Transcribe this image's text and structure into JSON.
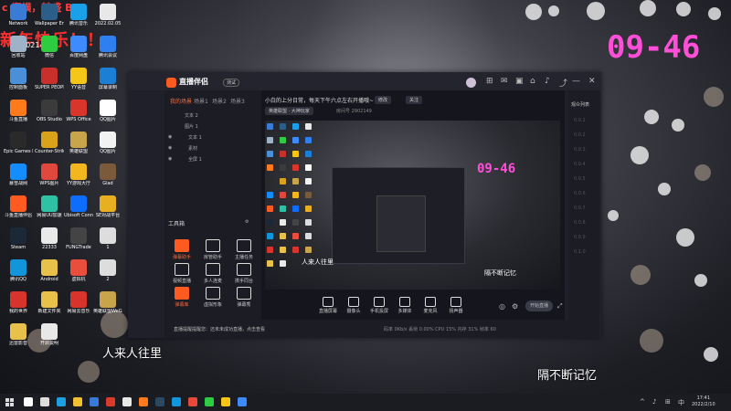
{
  "desktop": {
    "banner": "c 楔横，转盛 B",
    "new_year": "新年快乐！！",
    "count": "2902149",
    "clock": "09-46",
    "overlay_left": "人来人往里",
    "overlay_right": "隔不断记忆",
    "icons": [
      {
        "label": "Network",
        "color": "#3a7bd5"
      },
      {
        "label": "Wallpaper Engine",
        "color": "#2b5f8a"
      },
      {
        "label": "腾讯音乐",
        "color": "#1aa0e8"
      },
      {
        "label": "2022.02.05",
        "color": "#e8e8e8"
      },
      {
        "label": "回收站",
        "color": "#9fb3c8"
      },
      {
        "label": "微信",
        "color": "#2ecc40"
      },
      {
        "label": "百度网盘",
        "color": "#3d8bfd"
      },
      {
        "label": "腾讯会议",
        "color": "#2f7ff0"
      },
      {
        "label": "控制面板",
        "color": "#4a90d9"
      },
      {
        "label": "SUPER PEOPLE CBT",
        "color": "#c9302c"
      },
      {
        "label": "YY语音",
        "color": "#f5c518"
      },
      {
        "label": "屏幕录制",
        "color": "#1c7fd6"
      },
      {
        "label": "斗鱼直播",
        "color": "#ff7a1a"
      },
      {
        "label": "OBS Studio",
        "color": "#3b3b3b"
      },
      {
        "label": "WPS Office",
        "color": "#d9352b"
      },
      {
        "label": "QQ图片",
        "color": "#ffffff"
      },
      {
        "label": "Epic Games Launcher",
        "color": "#2a2a2a"
      },
      {
        "label": "Counter-Strike Global Off",
        "color": "#d9a21a"
      },
      {
        "label": "英雄联盟",
        "color": "#c8a44a"
      },
      {
        "label": "QQ图片",
        "color": "#f2f2f2"
      },
      {
        "label": "暴雪战网",
        "color": "#148eff"
      },
      {
        "label": "WPS图片",
        "color": "#e0483d"
      },
      {
        "label": "YY游戏大厅",
        "color": "#f3b61f"
      },
      {
        "label": "Glad",
        "color": "#7a5a3a"
      },
      {
        "label": "斗鱼直播伴侣",
        "color": "#ff5a1f"
      },
      {
        "label": "网易UU加速",
        "color": "#2fc1a3"
      },
      {
        "label": "Ubisoft Connect",
        "color": "#0d6efd"
      },
      {
        "label": "SE对战平台",
        "color": "#e8b020"
      },
      {
        "label": "Steam",
        "color": "#1b2838"
      },
      {
        "label": "22333",
        "color": "#e9e9e9"
      },
      {
        "label": "FUNGTrade",
        "color": "#444444"
      },
      {
        "label": "1",
        "color": "#dddddd"
      },
      {
        "label": "腾讯QQ",
        "color": "#1296db"
      },
      {
        "label": "Android",
        "color": "#e8c14a"
      },
      {
        "label": "虚拟机",
        "color": "#e94e3c"
      },
      {
        "label": "2",
        "color": "#dddddd"
      },
      {
        "label": "我的世界",
        "color": "#d9342b"
      },
      {
        "label": "新建文件夹",
        "color": "#e8c14a"
      },
      {
        "label": "网易云音乐",
        "color": "#d9342b"
      },
      {
        "label": "英雄联盟WeGame",
        "color": "#c9a44a"
      },
      {
        "label": "迅雷影音",
        "color": "#e8c14a"
      },
      {
        "label": "开启说明",
        "color": "#e8e8e8"
      }
    ]
  },
  "window": {
    "app_name": "直播伴侣",
    "version": "测试",
    "controls": {
      "minimize": "—",
      "maximize": "□",
      "close": "✕"
    },
    "left_tabs": [
      "我的场景",
      "场景1",
      "场景2",
      "场景3"
    ],
    "scenes": [
      "文本 2",
      "图片 1",
      "文本 1",
      "素材",
      "全屏 1"
    ],
    "tools_label": "工具箱",
    "tools": [
      "弹幕助手",
      "房管助手",
      "主播任务",
      "视频直播",
      "多人连麦",
      "携手同台",
      "弹幕库",
      "虚拟形象",
      "弹幕秀"
    ],
    "header_text": "小白的上分日常，每天下午六点左右开播哦~",
    "header_edit": "修改",
    "header_btn2": "关注",
    "category": "英雄联盟 · 大神玩家",
    "room_id": "房间号 2902149",
    "preview_overlay_left": "人来人往里",
    "preview_overlay_right": "隔不断记忆",
    "preview_clock": "09-46",
    "bottom_tools": [
      "直播屏幕",
      "摄像头",
      "手机投屏",
      "多媒体",
      "麦克风",
      "扬声器"
    ],
    "live_button": "开始直播",
    "right_title": "观众列表",
    "right_rows": [
      "0.0.1",
      "0.0.2",
      "0.0.3",
      "0.0.4",
      "0.0.5",
      "0.0.6",
      "0.0.7",
      "0.0.8",
      "0.0.9",
      "0.1.0"
    ],
    "status_message": "直播提醒提醒您：还未未成功直播，点击查看",
    "status_stats": "码率 0Kb/s   丢帧 0.00%   CPU 15%   内存 31%   帧率 60"
  },
  "taskbar": {
    "time": "17:41",
    "date": "2022/2/10",
    "tray_lang": "中",
    "tray_icons": [
      "^",
      "♪",
      "⊞"
    ],
    "icons": [
      {
        "name": "search",
        "color": "#ffffff"
      },
      {
        "name": "taskview",
        "color": "#dddddd"
      },
      {
        "name": "edge",
        "color": "#1fa0e0"
      },
      {
        "name": "explorer",
        "color": "#f2c032"
      },
      {
        "name": "store",
        "color": "#3a78d8"
      },
      {
        "name": "netease",
        "color": "#d93a2b"
      },
      {
        "name": "wegame",
        "color": "#e8e8e8"
      },
      {
        "name": "douyu",
        "color": "#ff7a1a"
      },
      {
        "name": "steam",
        "color": "#2a4860"
      },
      {
        "name": "qq",
        "color": "#1296db"
      },
      {
        "name": "app1",
        "color": "#e84a3a"
      },
      {
        "name": "app2",
        "color": "#2ecc40"
      },
      {
        "name": "app3",
        "color": "#f5c518"
      },
      {
        "name": "app4",
        "color": "#3d8bfd"
      }
    ]
  }
}
